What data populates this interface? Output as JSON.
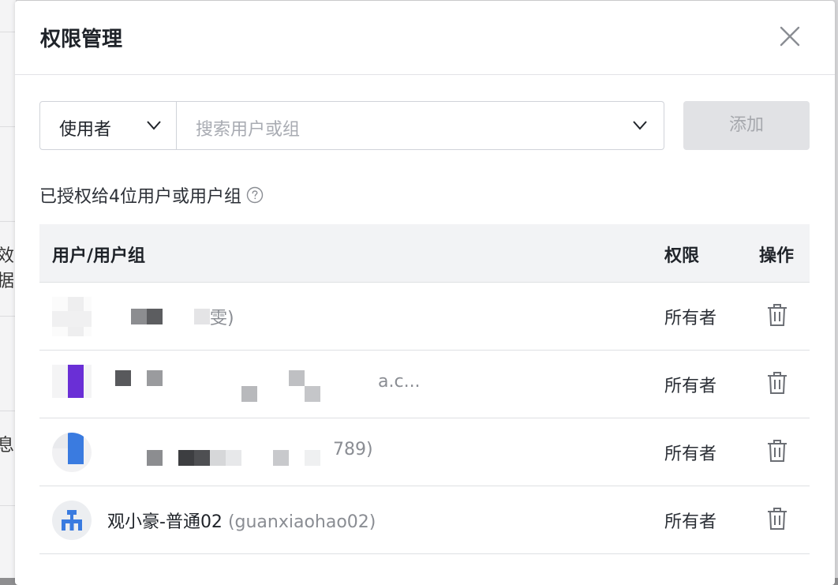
{
  "background": {
    "left_text_1": "效据",
    "left_text_2": "息"
  },
  "modal": {
    "title": "权限管理",
    "close_icon": "close-icon"
  },
  "controls": {
    "type_select_value": "使用者",
    "search_placeholder": "搜索用户或组",
    "add_button_label": "添加"
  },
  "summary": {
    "text": "已授权给4位用户或用户组",
    "help_icon": "question-circle-icon"
  },
  "table": {
    "headers": {
      "user": "用户/用户组",
      "permission": "权限",
      "action": "操作"
    },
    "rows": [
      {
        "name_visible": "",
        "account_visible": "雯)",
        "permission": "所有者",
        "action_icon": "trash-icon"
      },
      {
        "name_visible": "",
        "account_visible": "a.c...",
        "permission": "所有者",
        "action_icon": "trash-icon"
      },
      {
        "name_visible": "",
        "account_visible": "789)",
        "permission": "所有者",
        "action_icon": "trash-icon"
      },
      {
        "name_visible": "观小豪-普通02",
        "account_visible": "(guanxiaohao02)",
        "permission": "所有者",
        "action_icon": "trash-icon"
      }
    ]
  },
  "colors": {
    "accent_blue": "#3a7be0",
    "accent_purple": "#6a2fd6",
    "disabled_button_bg": "#e1e2e5",
    "header_bg": "#f2f3f5"
  }
}
